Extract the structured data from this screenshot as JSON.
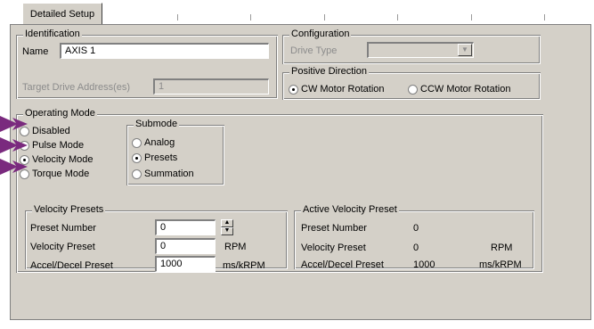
{
  "tab": {
    "label": "Detailed Setup"
  },
  "identification": {
    "title": "Identification",
    "name_label": "Name",
    "name_value": "AXIS 1",
    "target_label": "Target Drive Address(es)",
    "target_value": "1"
  },
  "configuration": {
    "title": "Configuration",
    "drive_type_label": "Drive Type",
    "drive_type_value": ""
  },
  "positive_direction": {
    "title": "Positive Direction",
    "options": [
      "CW Motor Rotation",
      "CCW Motor Rotation"
    ],
    "selected": "CW Motor Rotation"
  },
  "operating_mode": {
    "title": "Operating Mode",
    "options": [
      "Disabled",
      "Pulse Mode",
      "Velocity Mode",
      "Torque Mode"
    ],
    "selected": "Velocity Mode"
  },
  "submode": {
    "title": "Submode",
    "options": [
      "Analog",
      "Presets",
      "Summation"
    ],
    "selected": "Presets"
  },
  "velocity_presets": {
    "title": "Velocity Presets",
    "preset_number_label": "Preset Number",
    "preset_number_value": "0",
    "velocity_preset_label": "Velocity Preset",
    "velocity_preset_value": "0",
    "velocity_unit": "RPM",
    "accel_label": "Accel/Decel Preset",
    "accel_value": "1000",
    "accel_unit": "ms/kRPM"
  },
  "active_velocity_preset": {
    "title": "Active Velocity Preset",
    "preset_number_label": "Preset Number",
    "preset_number_value": "0",
    "velocity_preset_label": "Velocity Preset",
    "velocity_preset_value": "0",
    "velocity_unit": "RPM",
    "accel_label": "Accel/Decel Preset",
    "accel_value": "1000",
    "accel_unit": "ms/kRPM"
  },
  "colors": {
    "face": "#d4d0c8",
    "arrow": "#7a2a7e"
  }
}
